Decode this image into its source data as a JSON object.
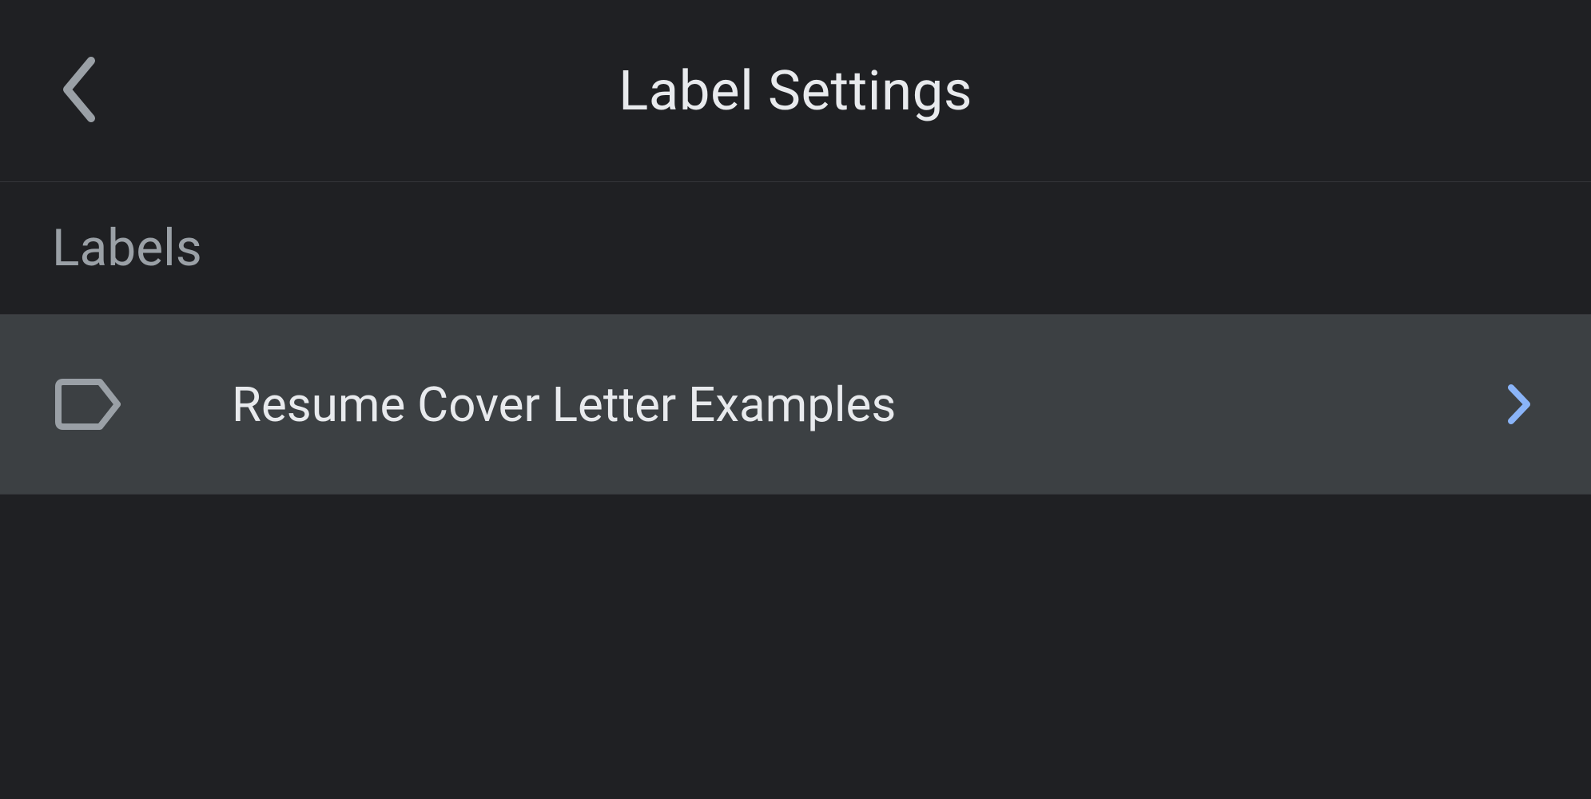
{
  "header": {
    "title": "Label Settings"
  },
  "section": {
    "title": "Labels"
  },
  "labels": {
    "items": [
      {
        "name": "Resume Cover Letter Examples"
      }
    ]
  }
}
